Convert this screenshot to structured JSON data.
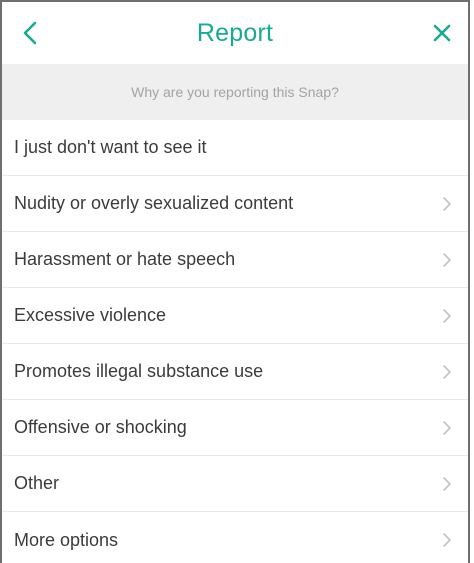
{
  "header": {
    "title": "Report",
    "back_icon": "chevron-left-icon",
    "close_icon": "close-icon",
    "accent_color": "#1aa992"
  },
  "subheader": {
    "text": "Why are you reporting this Snap?"
  },
  "options": [
    {
      "label": "I just don't want to see it",
      "has_chevron": false
    },
    {
      "label": "Nudity or overly sexualized content",
      "has_chevron": true
    },
    {
      "label": "Harassment or hate speech",
      "has_chevron": true
    },
    {
      "label": "Excessive violence",
      "has_chevron": true
    },
    {
      "label": "Promotes illegal substance use",
      "has_chevron": true
    },
    {
      "label": "Offensive or shocking",
      "has_chevron": true
    },
    {
      "label": "Other",
      "has_chevron": true
    },
    {
      "label": "More options",
      "has_chevron": true
    }
  ]
}
